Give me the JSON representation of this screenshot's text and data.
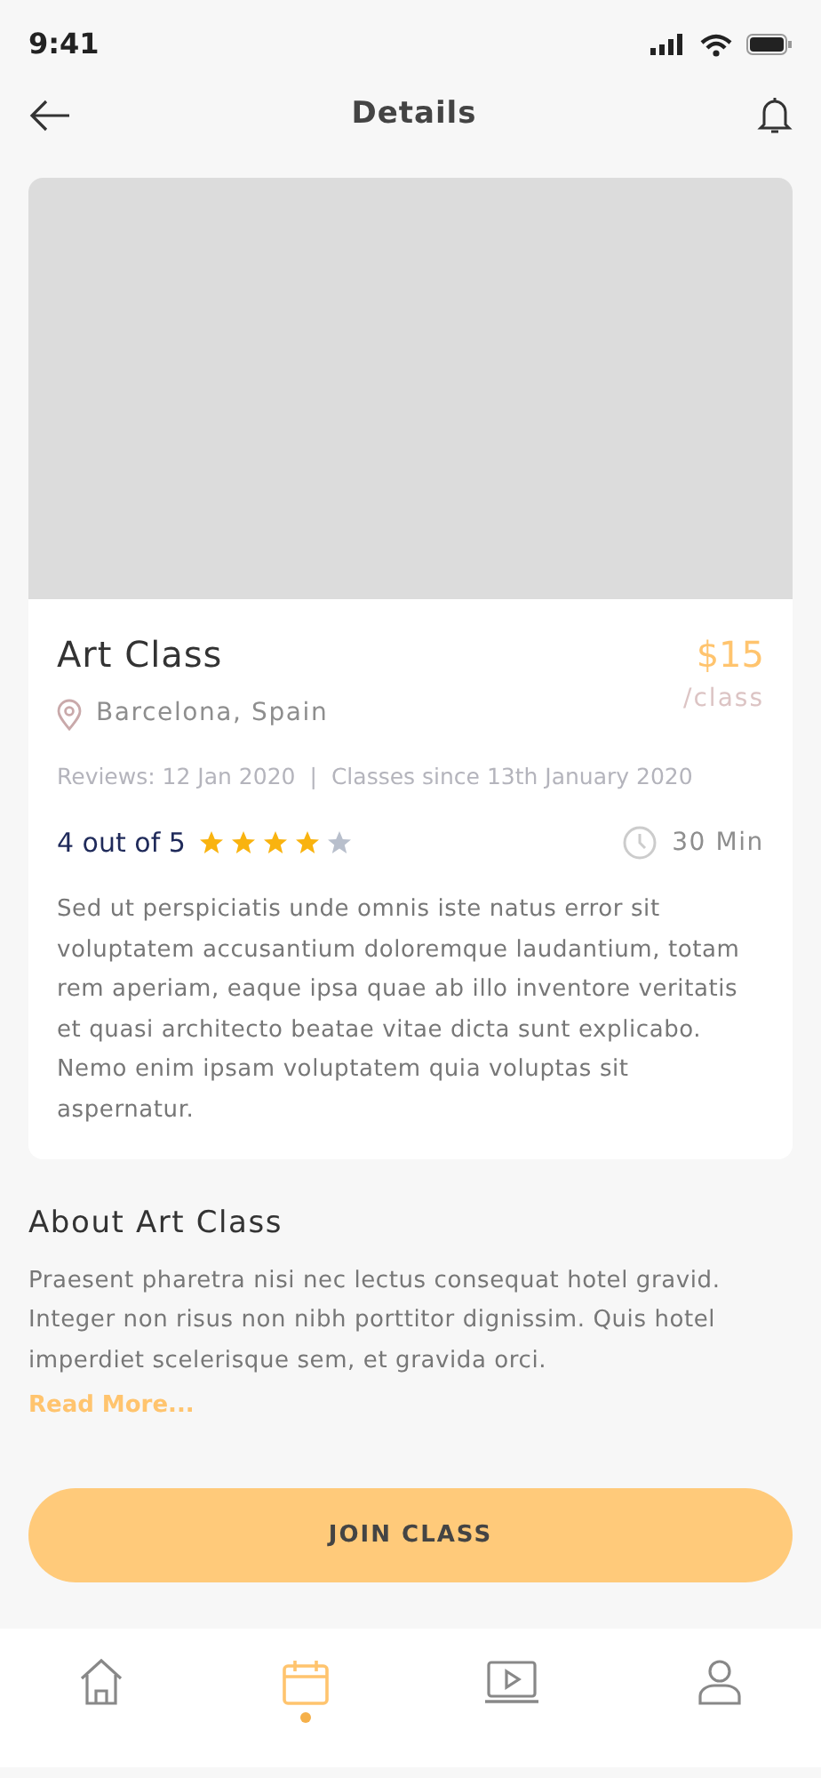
{
  "status_bar": {
    "time": "9:41"
  },
  "header": {
    "title": "Details"
  },
  "class_card": {
    "title": "Art Class",
    "location": "Barcelona, Spain",
    "price": "$15",
    "price_unit": "/class",
    "meta": [
      "Reviews: 12 Jan 2020",
      "Classes since 13th January 2020"
    ],
    "meta_separator": "|",
    "rating_text": "4 out of 5",
    "stars": 4,
    "duration": "30 Min",
    "description": "Sed ut perspiciatis unde omnis iste natus error sit voluptatem accusantium doloremque laudantium, totam rem aperiam, eaque ipsa quae ab illo inventore veritatis et quasi architecto beatae vitae dicta sunt explicabo. Nemo enim ipsam voluptatem quia voluptas sit aspernatur."
  },
  "about": {
    "title": "About Art Class",
    "text": "Praesent pharetra nisi nec lectus consequat hotel gravid. Integer non risus non nibh porttitor dignissim. Quis hotel imperdiet scelerisque sem, et gravida orci.",
    "link": "Read More..."
  },
  "primary_button": "JOIN CLASS",
  "bottom_nav": [
    {
      "kind": "home",
      "selected": false
    },
    {
      "kind": "calendar",
      "selected": true
    },
    {
      "kind": "video",
      "selected": false
    },
    {
      "kind": "profile",
      "selected": false
    }
  ]
}
